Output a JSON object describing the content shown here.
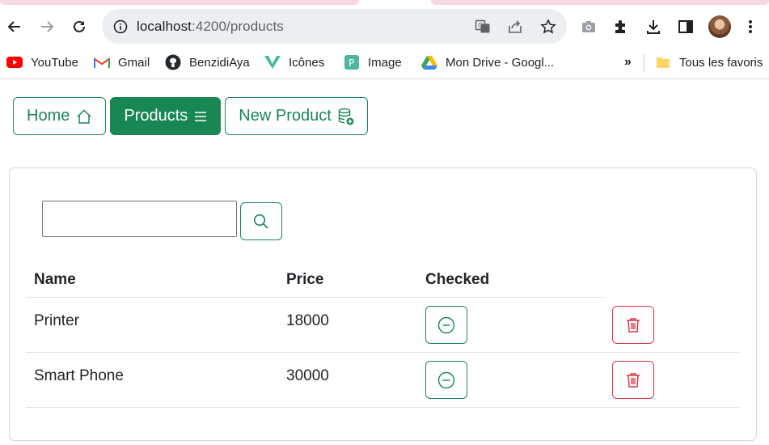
{
  "browser": {
    "url_host": "localhost",
    "url_path": ":4200/products",
    "bookmarks": [
      {
        "label": "YouTube",
        "icon": "youtube-icon"
      },
      {
        "label": "Gmail",
        "icon": "gmail-icon"
      },
      {
        "label": "BenzidiAya",
        "icon": "github-icon"
      },
      {
        "label": "Icônes",
        "icon": "icones-icon"
      },
      {
        "label": "Image",
        "icon": "image-icon"
      },
      {
        "label": "Mon Drive - Googl...",
        "icon": "google-drive-icon"
      }
    ],
    "more_bookmarks": "»",
    "all_bookmarks": "Tous les favoris"
  },
  "nav": {
    "home": "Home",
    "products": "Products",
    "new_product": "New Product"
  },
  "search": {
    "placeholder": "",
    "value": ""
  },
  "table": {
    "headers": [
      "Name",
      "Price",
      "Checked"
    ],
    "rows": [
      {
        "name": "Printer",
        "price": "18000",
        "checked": false
      },
      {
        "name": "Smart Phone",
        "price": "30000",
        "checked": false
      }
    ]
  },
  "colors": {
    "primary": "#198754",
    "danger": "#dc3545",
    "tab_accent": "#f6d7e3"
  }
}
